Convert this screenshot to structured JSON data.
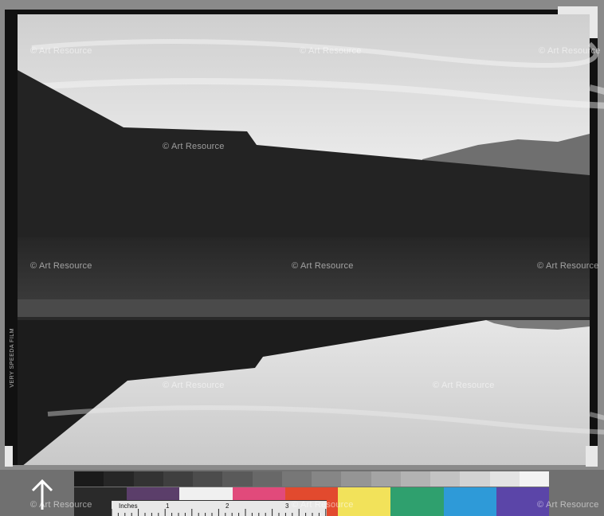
{
  "image": {
    "watermark_text": "© Art Resource",
    "film_edge_text": "VERY SPEEDA FILM",
    "colors": {
      "sky": "#e4e4e4",
      "hill": "#232323",
      "ground": "#2f2f2f",
      "shore": "#4a4a4a",
      "water": "#d8d8d8",
      "frame": "#111111",
      "background": "#8a8a8a"
    }
  },
  "target": {
    "ruler_label": "Inches",
    "ruler_numbers": [
      "1",
      "2",
      "3"
    ],
    "gray_patches": [
      "#1a1a1a",
      "#262626",
      "#333333",
      "#3f3f3f",
      "#4c4c4c",
      "#5a5a5a",
      "#686868",
      "#777777",
      "#868686",
      "#959595",
      "#a4a4a4",
      "#b3b3b3",
      "#c3c3c3",
      "#d3d3d3",
      "#e3e3e3",
      "#f3f3f3"
    ],
    "color_patches": [
      "#2a2a2a",
      "#5b3e6a",
      "#f0f0f0",
      "#e14a7b",
      "#e24a2e",
      "#f2e25a",
      "#2fa06e",
      "#2e9ad8",
      "#5b45a8"
    ]
  }
}
